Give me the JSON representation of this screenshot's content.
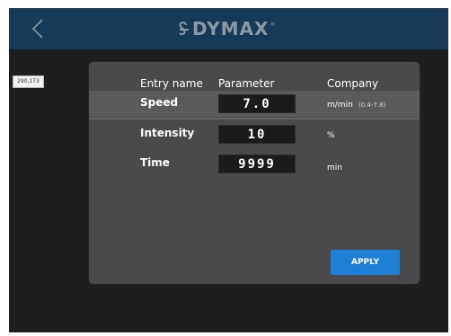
{
  "header": {
    "back_icon": "chevron-left-icon",
    "logo": "DYMAX",
    "logo_mark": "®"
  },
  "coord_badge": "290,173",
  "table": {
    "columns": [
      "Entry name",
      "Parameter",
      "Company"
    ],
    "rows": [
      {
        "name": "Speed",
        "value": "7.0",
        "unit": "m/min",
        "range": "(0.4-7.8)"
      },
      {
        "name": "Intensity",
        "value": "10",
        "unit": "%",
        "range": ""
      },
      {
        "name": "Time",
        "value": "9999",
        "unit": "min",
        "range": ""
      }
    ]
  },
  "apply_label": "APPLY",
  "colors": {
    "topbar": "#183a59",
    "screen_bg": "#1e1e20",
    "panel_bg": "#4a4a4c",
    "highlight_row": "#595a5c",
    "input_bg": "#1b1b1d",
    "accent": "#1f7fd4"
  }
}
